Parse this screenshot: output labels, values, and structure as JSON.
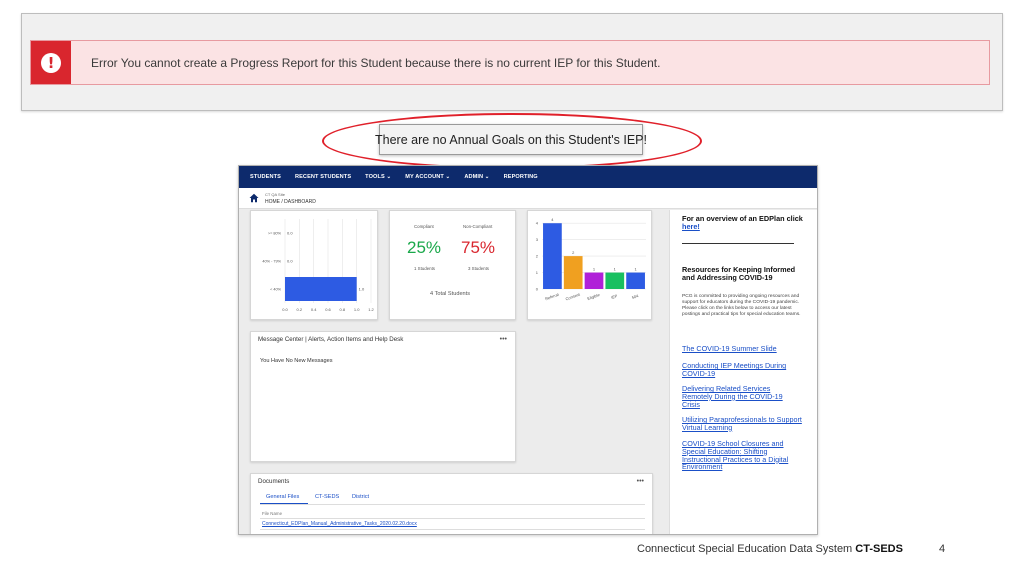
{
  "error": {
    "message": "Error You cannot create a Progress Report for this Student because there is no current IEP for this Student.",
    "icon": "exclamation-circle-icon",
    "color": "#d9262e"
  },
  "callout": {
    "text": "There are no Annual Goals on this Student's IEP!"
  },
  "app": {
    "nav": [
      "STUDENTS",
      "RECENT STUDENTS",
      "TOOLS ⌄",
      "MY ACCOUNT ⌄",
      "ADMIN ⌄",
      "REPORTING"
    ],
    "site": "CT QA Site",
    "breadcrumb": "HOME / DASHBOARD",
    "bar_chart_1": {
      "categories": [
        ">= 80%",
        "40% - 79%",
        "< 40%"
      ],
      "values": [
        0.0,
        0.0,
        1.0
      ],
      "value_labels": [
        "0.0",
        "0.0",
        "1.0"
      ],
      "ticks": [
        "0.0",
        "0.2",
        "0.4",
        "0.6",
        "0.8",
        "1.0",
        "1.2"
      ],
      "xlim": [
        0,
        1.2
      ]
    },
    "compliance": {
      "compliant_label": "Compliant",
      "noncompliant_label": "Non-Compliant",
      "compliant_pct": "25%",
      "noncompliant_pct": "75%",
      "compliant_count": "1 Students",
      "noncompliant_count": "3 Students",
      "total": "4 Total Students"
    },
    "bar_chart_2": {
      "categories": [
        "Referral",
        "Consent",
        "Eligible",
        "IEP",
        "504"
      ],
      "values": [
        4,
        2,
        1,
        1,
        1
      ],
      "value_labels": [
        "4",
        "2",
        "1",
        "1",
        "1"
      ],
      "colors": [
        "#2d5be3",
        "#f0a020",
        "#b020d8",
        "#18c060",
        "#2d5be3"
      ],
      "yticks": [
        "0",
        "1",
        "2",
        "3",
        "4"
      ],
      "ylim": [
        0,
        4.5
      ]
    },
    "messages": {
      "title": "Message Center | Alerts, Action Items and Help Desk",
      "empty": "You Have No New Messages",
      "menu": "•••"
    },
    "documents": {
      "title": "Documents",
      "menu": "•••",
      "tabs": [
        "General Files",
        "CT-SEDS",
        "District"
      ],
      "column": "File Name",
      "file": "Connecticut_EDPlan_Manual_Administrative_Tasks_2020.02.20.docx"
    },
    "side": {
      "overview_text": "For an overview of an EDPlan click ",
      "overview_link": "here!",
      "resources_head": "Resources for Keeping Informed and Addressing COVID-19",
      "body": "PCG is committed to providing ongoing resources and support for educators during the COVID-19 pandemic. Please click on the links below to access our latest postings and practical tips for special education teams.",
      "links": [
        "The COVID-19 Summer Slide",
        "Conducting IEP Meetings During COVID-19",
        "Delivering Related Services Remotely During the COVID-19 Crisis",
        "Utilizing Paraprofessionals to Support Virtual Learning",
        "COVID-19 School Closures and Special Education: Shifting Instructional Practices to a Digital Environment"
      ]
    }
  },
  "footer": {
    "text": "Connecticut Special Education Data System ",
    "bold": "CT-SEDS",
    "page": "4"
  }
}
